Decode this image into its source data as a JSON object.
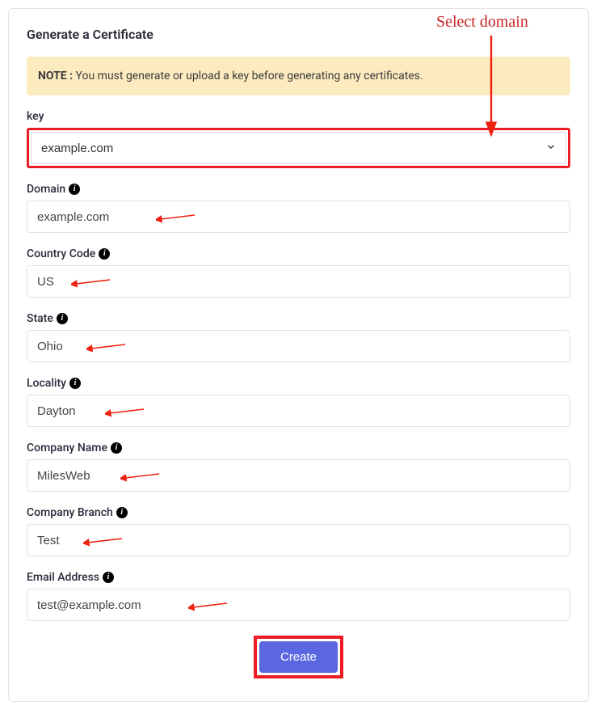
{
  "page_title": "Generate a Certificate",
  "note": {
    "prefix": "NOTE :",
    "text": " You must generate or upload a key before generating any certificates."
  },
  "callout_text": "Select domain",
  "key": {
    "label": "key",
    "value": "example.com"
  },
  "fields": {
    "domain": {
      "label": "Domain",
      "value": "example.com"
    },
    "country": {
      "label": "Country Code",
      "value": "US"
    },
    "state": {
      "label": "State",
      "value": "Ohio"
    },
    "locality": {
      "label": "Locality",
      "value": "Dayton"
    },
    "company_name": {
      "label": "Company Name",
      "value": "MilesWeb"
    },
    "company_branch": {
      "label": "Company Branch",
      "value": "Test"
    },
    "email": {
      "label": "Email Address",
      "value": "test@example.com"
    }
  },
  "create_button": "Create"
}
